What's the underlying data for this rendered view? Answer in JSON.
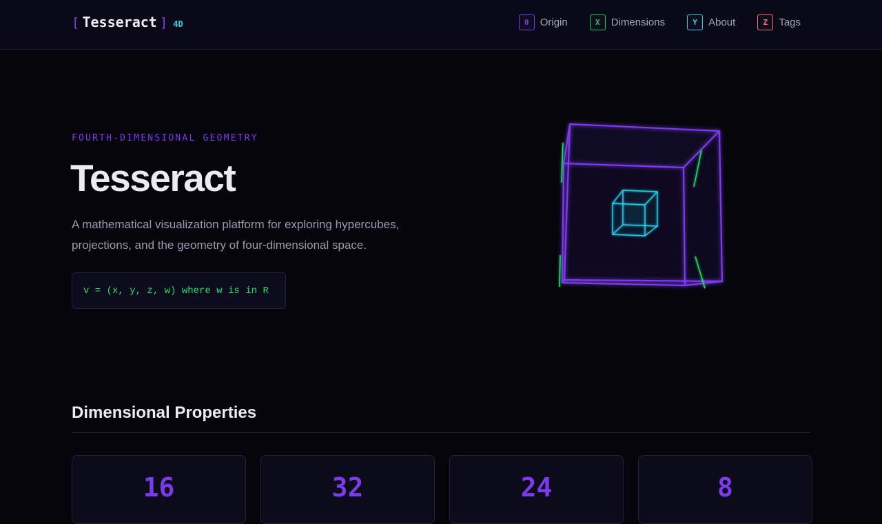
{
  "header": {
    "logo": {
      "bracket_open": "[",
      "name": "Tesseract",
      "bracket_close": "]",
      "badge": "4D"
    },
    "nav": [
      {
        "key": "0",
        "label": "Origin",
        "color": "#7c3aed"
      },
      {
        "key": "X",
        "label": "Dimensions",
        "color": "#22c55e"
      },
      {
        "key": "Y",
        "label": "About",
        "color": "#22d3ee"
      },
      {
        "key": "Z",
        "label": "Tags",
        "color": "#f87171"
      }
    ]
  },
  "hero": {
    "eyebrow": "FOURTH-DIMENSIONAL GEOMETRY",
    "title": "Tesseract",
    "description": "A mathematical visualization platform for exploring hypercubes, projections, and the geometry of four-dimensional space.",
    "formula": "v = (x, y, z, w) where w is in R"
  },
  "properties": {
    "title": "Dimensional Properties",
    "values": [
      "16",
      "32",
      "24",
      "8"
    ]
  },
  "colors": {
    "accent": "#7c3aed",
    "cyan": "#22d3ee",
    "green": "#22c55e",
    "red": "#f87171",
    "background": "#05050b"
  }
}
